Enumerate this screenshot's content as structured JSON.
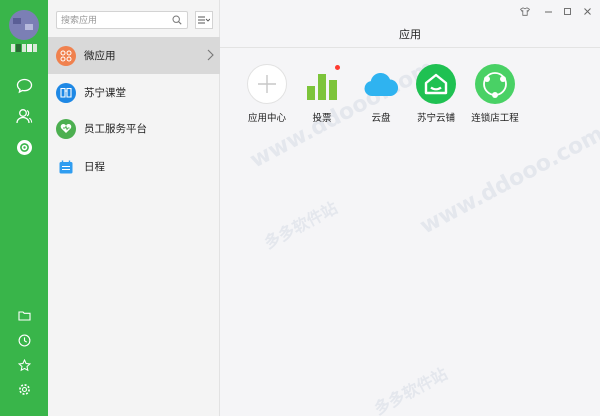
{
  "window": {
    "title": "应用"
  },
  "search": {
    "placeholder": "搜索应用"
  },
  "list": {
    "items": [
      {
        "label": "微应用",
        "icon": "apps-grid-icon",
        "color": "#f0814e",
        "selected": true
      },
      {
        "label": "苏宁课堂",
        "icon": "book-icon",
        "color": "#1e88e5"
      },
      {
        "label": "员工服务平台",
        "icon": "heart-icon",
        "color": "#4caf50"
      },
      {
        "label": "日程",
        "icon": "calendar-icon",
        "color": "#2f9df0"
      }
    ]
  },
  "apps": [
    {
      "label": "应用中心",
      "icon": "plus-icon",
      "color": "#ffffff"
    },
    {
      "label": "投票",
      "icon": "vote-bars-icon",
      "color": "#7cc43a",
      "badge": true
    },
    {
      "label": "云盘",
      "icon": "cloud-icon",
      "color": "#2fb3f0"
    },
    {
      "label": "苏宁云铺",
      "icon": "store-icon",
      "color": "#1fc152"
    },
    {
      "label": "连锁店工程",
      "icon": "cycle-icon",
      "color": "#49d165"
    }
  ],
  "colors": {
    "rail": "#39b54a",
    "accent": "#3cb371"
  },
  "watermark": {
    "text": "www.ddooo.com",
    "text2": "多多软件站"
  }
}
